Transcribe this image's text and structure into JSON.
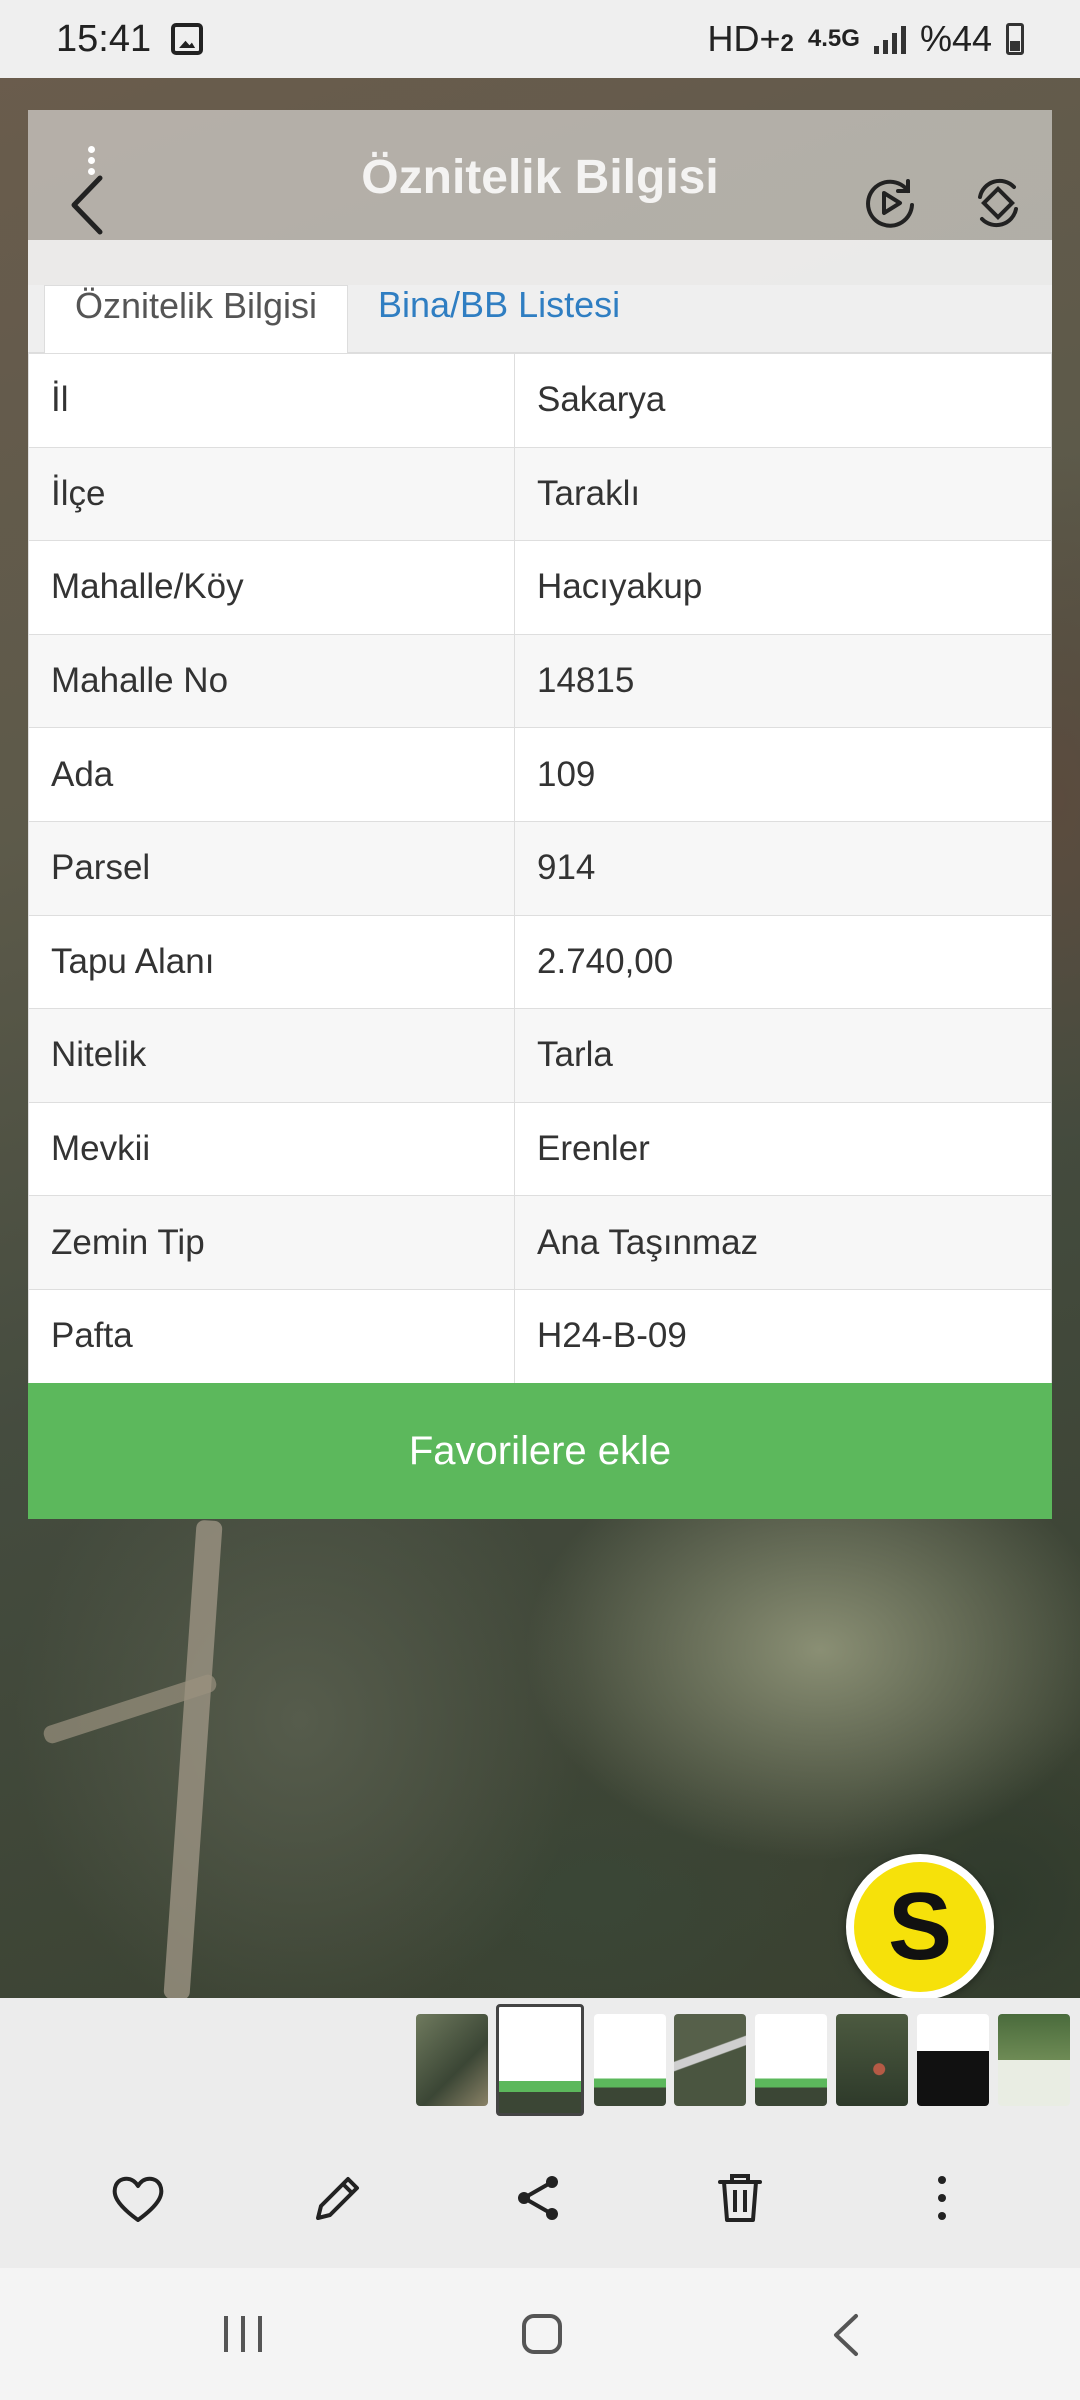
{
  "status_bar": {
    "time": "15:41",
    "network": "HD+",
    "network_sub": "2",
    "network_type": "4.5G",
    "battery": "%44"
  },
  "header": {
    "title": "Öznitelik Bilgisi"
  },
  "tabs": [
    {
      "label": "Öznitelik Bilgisi"
    },
    {
      "label": "Bina/BB Listesi"
    }
  ],
  "attributes": [
    {
      "key": "İl",
      "value": "Sakarya"
    },
    {
      "key": "İlçe",
      "value": "Taraklı"
    },
    {
      "key": "Mahalle/Köy",
      "value": "Hacıyakup"
    },
    {
      "key": "Mahalle No",
      "value": "14815"
    },
    {
      "key": "Ada",
      "value": "109"
    },
    {
      "key": "Parsel",
      "value": "914"
    },
    {
      "key": "Tapu Alanı",
      "value": "2.740,00"
    },
    {
      "key": "Nitelik",
      "value": "Tarla"
    },
    {
      "key": "Mevkii",
      "value": "Erenler"
    },
    {
      "key": "Zemin Tip",
      "value": "Ana Taşınmaz"
    },
    {
      "key": "Pafta",
      "value": "H24-B-09"
    }
  ],
  "favorites_button": "Favorilere ekle",
  "floating_badge": "S",
  "colors": {
    "accent_green": "#5cb85c",
    "tab_link_blue": "#2f7ec2",
    "badge_yellow": "#f6e10a"
  },
  "icons": {
    "back": "chevron-left-icon",
    "play_rotate": "play-rotate-icon",
    "rotate": "rotate-icon",
    "actions": [
      "heart-icon",
      "pencil-icon",
      "share-icon",
      "trash-icon",
      "more-vertical-icon"
    ],
    "nav": [
      "recents-icon",
      "home-icon",
      "back-icon"
    ]
  }
}
